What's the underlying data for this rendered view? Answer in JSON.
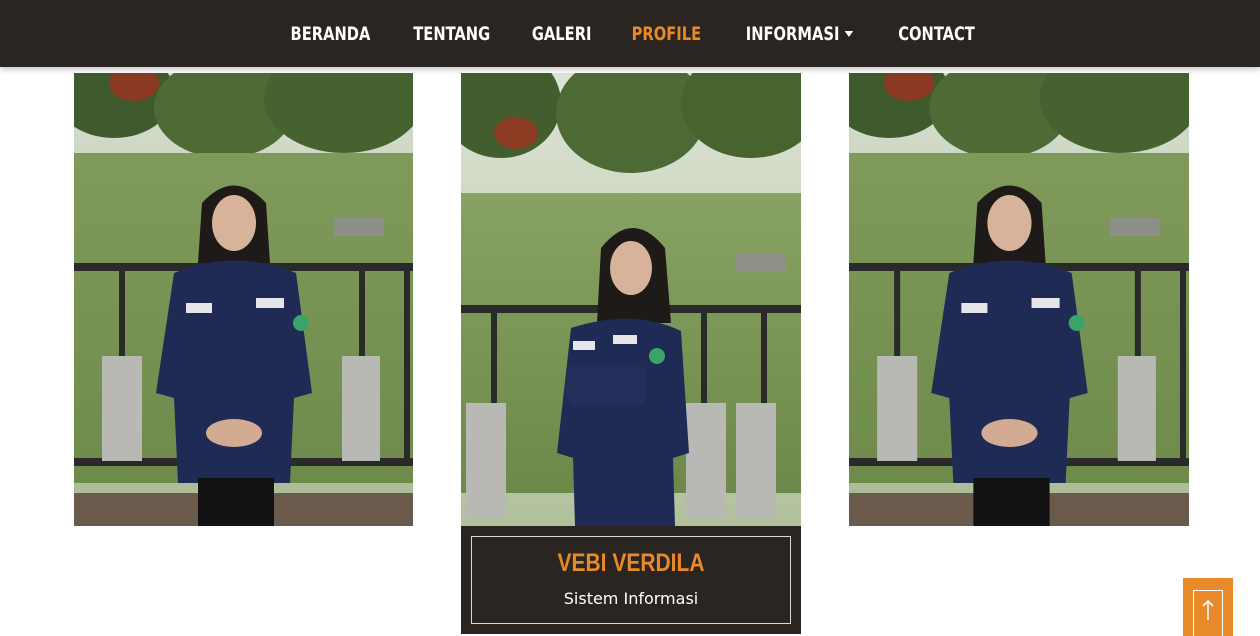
{
  "nav": {
    "items": [
      {
        "label": "BERANDA",
        "active": false
      },
      {
        "label": "TENTANG",
        "active": false
      },
      {
        "label": "GALERI",
        "active": false
      },
      {
        "label": "PROFILE",
        "active": true
      },
      {
        "label": "INFORMASI",
        "active": false,
        "dropdown": true
      },
      {
        "label": "CONTACT",
        "active": false
      }
    ]
  },
  "profile": {
    "featured": {
      "name": "VEBI VERDILA",
      "department": "Sistem Informasi"
    }
  },
  "colors": {
    "navbar_bg": "#2b2522",
    "accent": "#e8892a",
    "text_light": "#ffffff"
  },
  "icons": {
    "back_to_top": "arrow-up-icon",
    "dropdown": "caret-down-icon"
  }
}
